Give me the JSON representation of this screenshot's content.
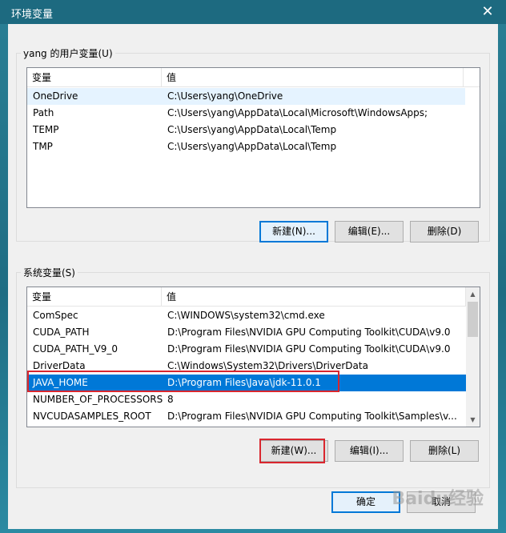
{
  "window": {
    "title": "环境变量"
  },
  "user_group": {
    "label": "yang 的用户变量(U)",
    "columns": [
      "变量",
      "值"
    ],
    "rows": [
      {
        "name": "OneDrive",
        "value": "C:\\Users\\yang\\OneDrive"
      },
      {
        "name": "Path",
        "value": "C:\\Users\\yang\\AppData\\Local\\Microsoft\\WindowsApps;"
      },
      {
        "name": "TEMP",
        "value": "C:\\Users\\yang\\AppData\\Local\\Temp"
      },
      {
        "name": "TMP",
        "value": "C:\\Users\\yang\\AppData\\Local\\Temp"
      }
    ],
    "buttons": {
      "new": "新建(N)...",
      "edit": "编辑(E)...",
      "delete": "删除(D)"
    }
  },
  "system_group": {
    "label": "系统变量(S)",
    "columns": [
      "变量",
      "值"
    ],
    "rows": [
      {
        "name": "ComSpec",
        "value": "C:\\WINDOWS\\system32\\cmd.exe"
      },
      {
        "name": "CUDA_PATH",
        "value": "D:\\Program Files\\NVIDIA GPU Computing Toolkit\\CUDA\\v9.0"
      },
      {
        "name": "CUDA_PATH_V9_0",
        "value": "D:\\Program Files\\NVIDIA GPU Computing Toolkit\\CUDA\\v9.0"
      },
      {
        "name": "DriverData",
        "value": "C:\\Windows\\System32\\Drivers\\DriverData"
      },
      {
        "name": "JAVA_HOME",
        "value": "D:\\Program Files\\Java\\jdk-11.0.1"
      },
      {
        "name": "NUMBER_OF_PROCESSORS",
        "value": "8"
      },
      {
        "name": "NVCUDASAMPLES_ROOT",
        "value": "D:\\Program Files\\NVIDIA GPU Computing Toolkit\\Samples\\v..."
      }
    ],
    "buttons": {
      "new": "新建(W)...",
      "edit": "编辑(I)...",
      "delete": "删除(L)"
    }
  },
  "dialog_buttons": {
    "ok": "确定",
    "cancel": "取消"
  },
  "watermark": "Baidu经验",
  "colors": {
    "selection": "#0078d7",
    "highlight_box": "#d9262e",
    "title_bar": "#1d6a80"
  }
}
